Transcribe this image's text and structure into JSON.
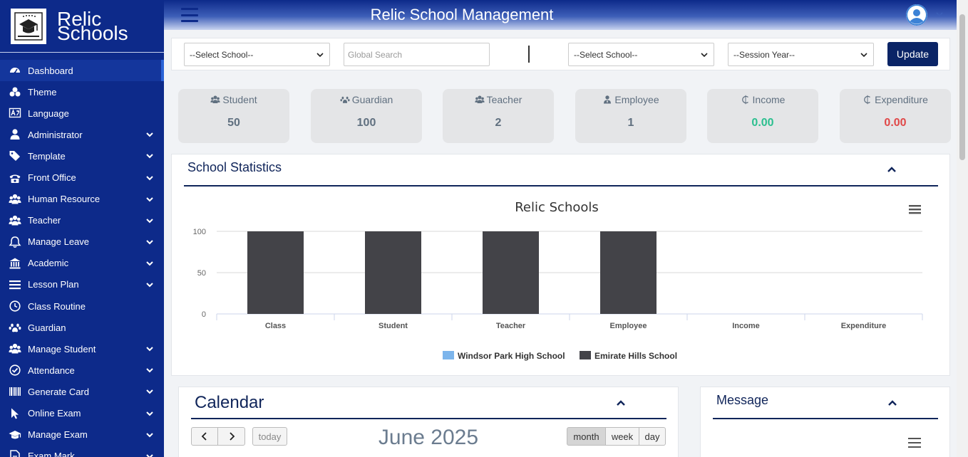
{
  "brand": {
    "line1": "Relic",
    "line2": "Schools"
  },
  "header": {
    "title": "Relic School Management"
  },
  "sidebar": {
    "items": [
      {
        "label": "Dashboard",
        "icon": "dashboard-icon",
        "expandable": false,
        "active": true
      },
      {
        "label": "Theme",
        "icon": "theme-icon",
        "expandable": false
      },
      {
        "label": "Language",
        "icon": "language-icon",
        "expandable": false
      },
      {
        "label": "Administrator",
        "icon": "user-icon",
        "expandable": true
      },
      {
        "label": "Template",
        "icon": "tags-icon",
        "expandable": true
      },
      {
        "label": "Front Office",
        "icon": "phone-icon",
        "expandable": true
      },
      {
        "label": "Human Resource",
        "icon": "users-icon",
        "expandable": true
      },
      {
        "label": "Teacher",
        "icon": "users-icon",
        "expandable": true
      },
      {
        "label": "Manage Leave",
        "icon": "bell-icon",
        "expandable": true
      },
      {
        "label": "Academic",
        "icon": "bank-icon",
        "expandable": true
      },
      {
        "label": "Lesson Plan",
        "icon": "bars-icon",
        "expandable": true
      },
      {
        "label": "Class Routine",
        "icon": "clock-icon",
        "expandable": false
      },
      {
        "label": "Guardian",
        "icon": "paw-icon",
        "expandable": false
      },
      {
        "label": "Manage Student",
        "icon": "users-icon",
        "expandable": true
      },
      {
        "label": "Attendance",
        "icon": "check-circle-icon",
        "expandable": true
      },
      {
        "label": "Generate Card",
        "icon": "barcode-icon",
        "expandable": true
      },
      {
        "label": "Online Exam",
        "icon": "pointer-icon",
        "expandable": true
      },
      {
        "label": "Manage Exam",
        "icon": "graduation-cap-icon",
        "expandable": true
      },
      {
        "label": "Exam Mark",
        "icon": "file-icon",
        "expandable": true
      }
    ]
  },
  "filters": {
    "school_select_1": "--Select School--",
    "search_placeholder": "Global Search",
    "school_select_2": "--Select School--",
    "session_select": "--Session Year--",
    "update_label": "Update"
  },
  "stats": [
    {
      "label": "Student",
      "value": "50",
      "icon": "users-icon",
      "color": "#607080"
    },
    {
      "label": "Guardian",
      "value": "100",
      "icon": "paw-icon",
      "color": "#607080"
    },
    {
      "label": "Teacher",
      "value": "2",
      "icon": "users-icon",
      "color": "#607080"
    },
    {
      "label": "Employee",
      "value": "1",
      "icon": "user-tie-icon",
      "color": "#607080"
    },
    {
      "label": "Income",
      "value": "0.00",
      "icon": "currency-icon",
      "color": "#2bbf8f"
    },
    {
      "label": "Expenditure",
      "value": "0.00",
      "icon": "currency-icon",
      "color": "#e04848"
    }
  ],
  "school_statistics": {
    "title": "School Statistics"
  },
  "chart_data": {
    "type": "bar",
    "title": "Relic Schools",
    "categories": [
      "Class",
      "Student",
      "Teacher",
      "Employee",
      "Income",
      "Expenditure"
    ],
    "series": [
      {
        "name": "Windsor Park High School",
        "color": "#7cb5ec",
        "values": [
          0,
          0,
          0,
          0,
          0,
          0
        ]
      },
      {
        "name": "Emirate Hills School",
        "color": "#434348",
        "values": [
          100,
          100,
          100,
          100,
          0,
          0
        ]
      }
    ],
    "yticks": [
      "0",
      "50",
      "100"
    ],
    "ylim": [
      0,
      100
    ],
    "grid": true,
    "legend": "bottom-center"
  },
  "calendar": {
    "title": "Calendar",
    "month_label": "June 2025",
    "today_label": "today",
    "views": [
      "month",
      "week",
      "day"
    ],
    "active_view": "month"
  },
  "message": {
    "title": "Message"
  },
  "colors": {
    "sidebar": "#0d2a8a",
    "accent": "#0a2466",
    "heading": "#10255a"
  }
}
